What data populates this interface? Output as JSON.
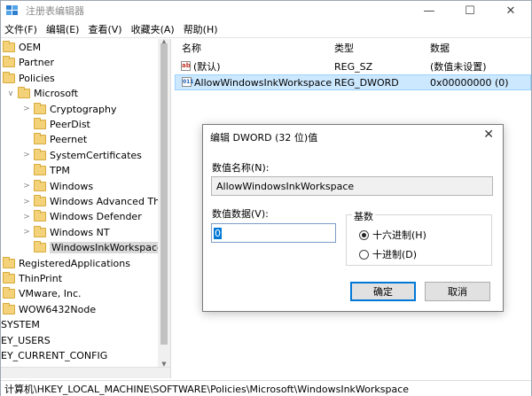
{
  "window": {
    "title": "注册表编辑器",
    "controls": {
      "minimize": "—",
      "maximize": "☐",
      "close": "✕"
    }
  },
  "menu": [
    "文件(F)",
    "编辑(E)",
    "查看(V)",
    "收藏夹(A)",
    "帮助(H)"
  ],
  "tree": [
    {
      "label": "OEM",
      "level": 1,
      "folder": true,
      "chevron": ""
    },
    {
      "label": "Partner",
      "level": 1,
      "folder": true,
      "chevron": ""
    },
    {
      "label": "Policies",
      "level": 1,
      "folder": true,
      "chevron": ""
    },
    {
      "label": "Microsoft",
      "level": 1,
      "folder": true,
      "chevron": "∨"
    },
    {
      "label": "Cryptography",
      "level": 2,
      "folder": true,
      "chevron": ">"
    },
    {
      "label": "PeerDist",
      "level": 2,
      "folder": true,
      "chevron": ""
    },
    {
      "label": "Peernet",
      "level": 2,
      "folder": true,
      "chevron": ""
    },
    {
      "label": "SystemCertificates",
      "level": 2,
      "folder": true,
      "chevron": ">"
    },
    {
      "label": "TPM",
      "level": 2,
      "folder": true,
      "chevron": ""
    },
    {
      "label": "Windows",
      "level": 2,
      "folder": true,
      "chevron": ">"
    },
    {
      "label": "Windows Advanced Thr",
      "level": 2,
      "folder": true,
      "chevron": ">"
    },
    {
      "label": "Windows Defender",
      "level": 2,
      "folder": true,
      "chevron": ">"
    },
    {
      "label": "Windows NT",
      "level": 2,
      "folder": true,
      "chevron": ">"
    },
    {
      "label": "WindowsInkWorkspace",
      "level": 2,
      "folder": true,
      "chevron": "",
      "selected": true
    },
    {
      "label": "RegisteredApplications",
      "level": 0,
      "folder": true,
      "chevron": ""
    },
    {
      "label": "ThinPrint",
      "level": 0,
      "folder": true,
      "chevron": ""
    },
    {
      "label": "VMware, Inc.",
      "level": 0,
      "folder": true,
      "chevron": ""
    },
    {
      "label": "WOW6432Node",
      "level": 0,
      "folder": true,
      "chevron": ""
    },
    {
      "label": "SYSTEM",
      "level": -1,
      "folder": false,
      "chevron": ""
    },
    {
      "label": "EY_USERS",
      "level": -1,
      "folder": false,
      "chevron": ""
    },
    {
      "label": "EY_CURRENT_CONFIG",
      "level": -1,
      "folder": false,
      "chevron": ""
    }
  ],
  "list": {
    "headers": {
      "name": "名称",
      "type": "类型",
      "data": "数据"
    },
    "rows": [
      {
        "icon": "ab",
        "name": "(默认)",
        "type": "REG_SZ",
        "data": "(数值未设置)",
        "selected": false
      },
      {
        "icon": "011",
        "name": "AllowWindowsInkWorkspace",
        "type": "REG_DWORD",
        "data": "0x00000000 (0)",
        "selected": true
      }
    ]
  },
  "statusbar": "计算机\\HKEY_LOCAL_MACHINE\\SOFTWARE\\Policies\\Microsoft\\WindowsInkWorkspace",
  "dialog": {
    "title": "编辑 DWORD (32 位)值",
    "close": "✕",
    "name_label": "数值名称(N):",
    "name_value": "AllowWindowsInkWorkspace",
    "data_label": "数值数据(V):",
    "data_value": "0",
    "base_label": "基数",
    "base_options": [
      {
        "label": "十六进制(H)",
        "checked": true
      },
      {
        "label": "十进制(D)",
        "checked": false
      }
    ],
    "ok": "确定",
    "cancel": "取消"
  }
}
